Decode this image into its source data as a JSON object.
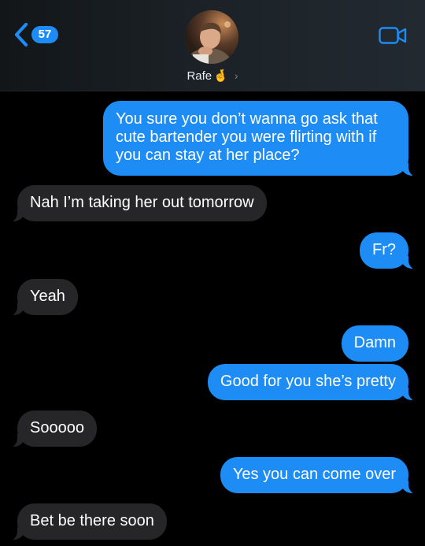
{
  "header": {
    "back_count": "57",
    "contact_name": "Rafe",
    "contact_emoji": "🤞",
    "chevron": "›",
    "icons": {
      "back": "chevron-left-icon",
      "video": "video-camera-icon"
    }
  },
  "colors": {
    "outgoing_bubble": "#1e8cf5",
    "incoming_bubble": "#262628",
    "background": "#000000",
    "accent": "#1e8cf5"
  },
  "messages": [
    {
      "direction": "outgoing",
      "lines": [
        "You sure you don’t wanna go ask that",
        "cute bartender you were flirting with if",
        "you can stay at her place?"
      ]
    },
    {
      "direction": "incoming",
      "text": "Nah I’m taking her out tomorrow"
    },
    {
      "direction": "outgoing",
      "text": "Fr?"
    },
    {
      "direction": "incoming",
      "text": "Yeah"
    },
    {
      "direction": "outgoing",
      "text": "Damn"
    },
    {
      "direction": "outgoing",
      "text": "Good for you she’s pretty"
    },
    {
      "direction": "incoming",
      "text": "Sooooo"
    },
    {
      "direction": "outgoing",
      "text": "Yes you can come over"
    },
    {
      "direction": "incoming",
      "text": "Bet be there soon"
    }
  ]
}
